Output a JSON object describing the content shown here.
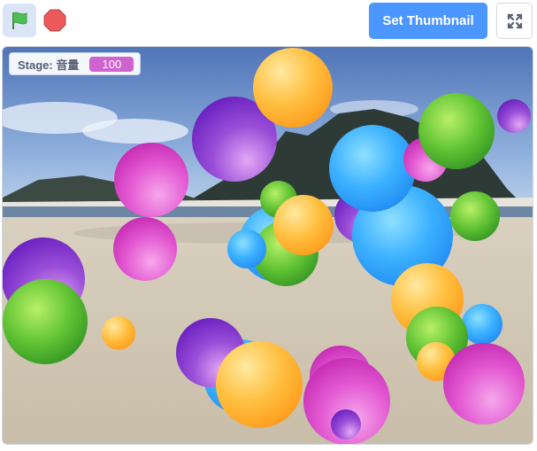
{
  "toolbar": {
    "green_flag_icon": "green-flag-icon",
    "stop_icon": "stop-icon",
    "set_thumbnail_label": "Set Thumbnail",
    "fullscreen_icon": "fullscreen-icon"
  },
  "stage": {
    "backdrop": "beach-with-mountain",
    "monitor": {
      "label": "Stage: 音量",
      "value": "100"
    },
    "ball_colors": [
      "orange",
      "purple",
      "green",
      "pink",
      "blue"
    ]
  },
  "colors": {
    "accent": "#4c97ff",
    "monitor_value": "#cf63cf",
    "flag_green": "#4cbf56",
    "stop_red": "#ec5959"
  }
}
